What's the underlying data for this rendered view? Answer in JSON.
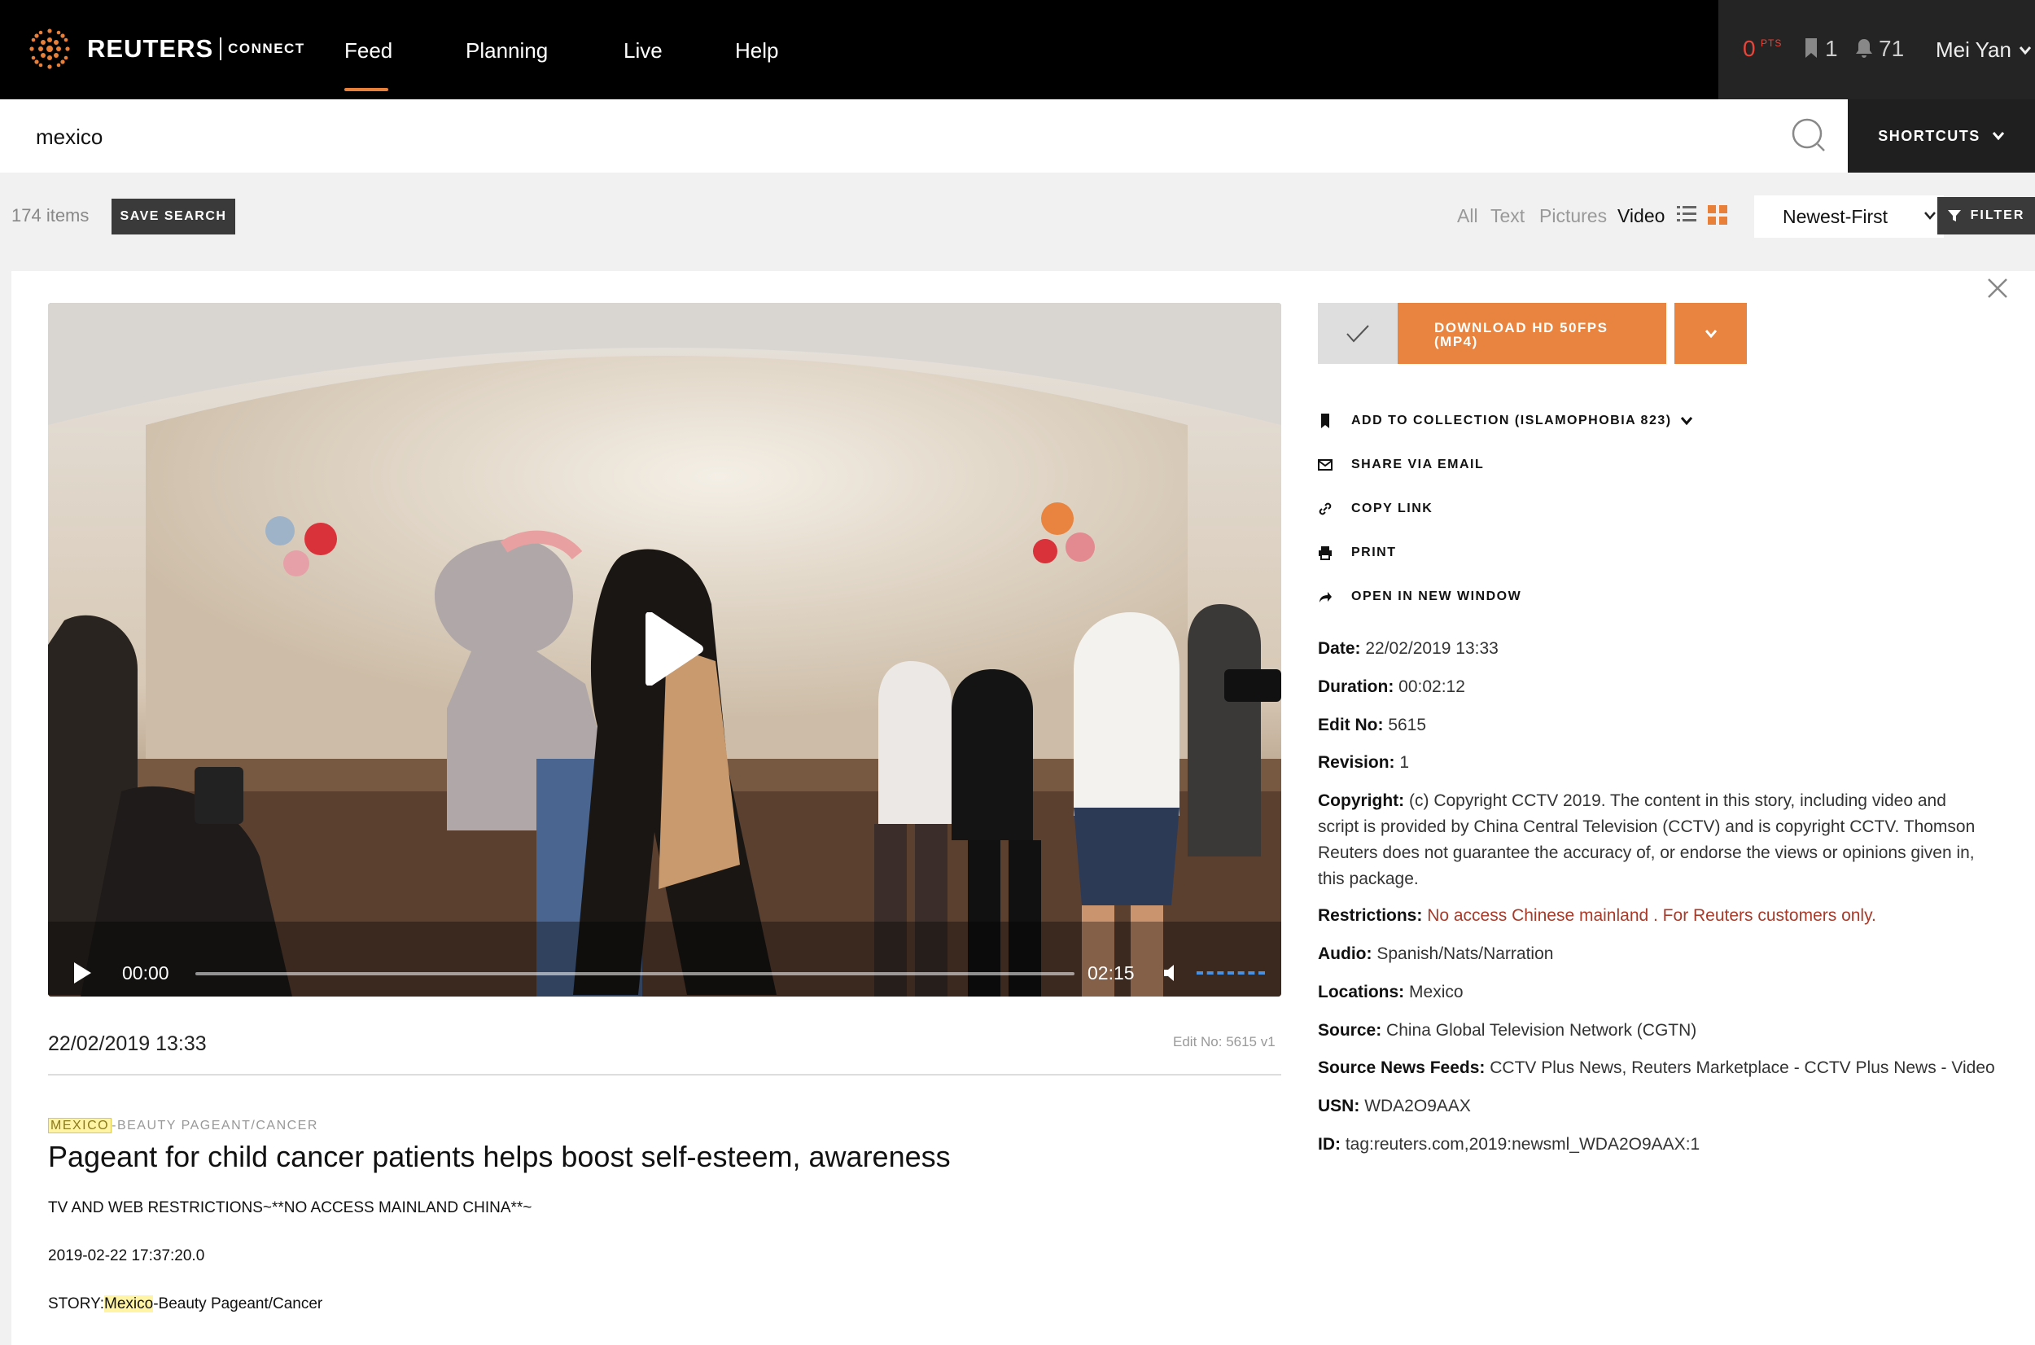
{
  "brand": {
    "name": "REUTERS",
    "product": "CONNECT"
  },
  "nav": {
    "items": [
      {
        "label": "Feed",
        "active": true
      },
      {
        "label": "Planning"
      },
      {
        "label": "Live"
      },
      {
        "label": "Help"
      }
    ],
    "accent": "#e8803a"
  },
  "user": {
    "points": "0",
    "points_unit": "PTS",
    "bookmarks": "1",
    "notifications": "71",
    "name": "Mei Yan"
  },
  "search": {
    "value": "mexico",
    "placeholder": ""
  },
  "shortcuts_label": "SHORTCUTS",
  "toolbar": {
    "items_count": "174 items",
    "save_search_label": "SAVE SEARCH",
    "types": [
      "All",
      "Text",
      "Pictures",
      "Video"
    ],
    "active_type": "Video",
    "sort": "Newest-First",
    "filter_label": "FILTER"
  },
  "player": {
    "current_time": "00:00",
    "duration": "02:15",
    "progress": 0
  },
  "story": {
    "date": "22/02/2019 13:33",
    "edit_no": "Edit No: 5615 v1",
    "slug_highlight": "MEXICO",
    "slug_rest": "-BEAUTY PAGEANT/CANCER",
    "headline": "Pageant for child cancer patients helps boost self-esteem, awareness",
    "lines": {
      "restrictions": "TV AND WEB RESTRICTIONS~**NO ACCESS MAINLAND CHINA**~",
      "timestamp": "2019-02-22 17:37:20.0",
      "story_prefix": "STORY:",
      "story_highlight": "Mexico",
      "story_rest": "-Beauty Pageant/Cancer"
    }
  },
  "actions": {
    "download_label": "DOWNLOAD HD 50FPS (MP4)",
    "collection": "ADD TO COLLECTION (ISLAMOPHOBIA 823)",
    "share": "SHARE VIA EMAIL",
    "copy": "COPY LINK",
    "print": "PRINT",
    "open": "OPEN IN NEW WINDOW"
  },
  "details": {
    "date": {
      "label": "Date:",
      "value": "22/02/2019 13:33"
    },
    "duration": {
      "label": "Duration:",
      "value": "00:02:12"
    },
    "edit_no": {
      "label": "Edit No:",
      "value": "5615"
    },
    "revision": {
      "label": "Revision:",
      "value": "1"
    },
    "copyright": {
      "label": "Copyright:",
      "value": "(c) Copyright CCTV 2019. The content in this story, including video and script is provided by China Central Television (CCTV) and is copyright CCTV. Thomson Reuters does not guarantee the accuracy of, or endorse the views or opinions given in, this package."
    },
    "restrictions": {
      "label": "Restrictions:",
      "value": "No access Chinese mainland . For Reuters customers only."
    },
    "audio": {
      "label": "Audio:",
      "value": "Spanish/Nats/Narration"
    },
    "locations": {
      "label": "Locations:",
      "value": "Mexico"
    },
    "source": {
      "label": "Source:",
      "value": "China Global Television Network (CGTN)"
    },
    "feeds": {
      "label": "Source News Feeds:",
      "value": "CCTV Plus News, Reuters Marketplace - CCTV Plus News - Video"
    },
    "usn": {
      "label": "USN:",
      "value": "WDA2O9AAX"
    },
    "id": {
      "label": "ID:",
      "value": "tag:reuters.com,2019:newsml_WDA2O9AAX:1"
    }
  }
}
